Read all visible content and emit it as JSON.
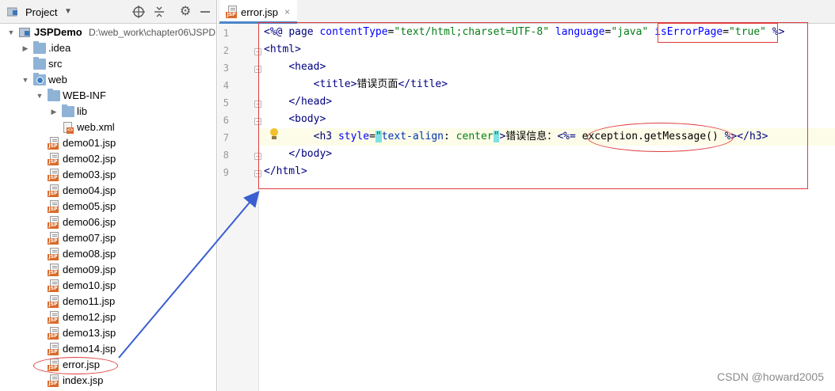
{
  "project_panel": {
    "title": "Project",
    "tree": [
      {
        "id": "jspdemo",
        "label": "JSPDemo",
        "path": "D:\\web_work\\chapter06\\JSPD",
        "depth": 0,
        "expanded": true,
        "icon": "module-icon",
        "bold": true
      },
      {
        "id": "idea",
        "label": ".idea",
        "depth": 1,
        "expanded": false,
        "icon": "folder-icon"
      },
      {
        "id": "src",
        "label": "src",
        "depth": 1,
        "icon": "folder-icon"
      },
      {
        "id": "web",
        "label": "web",
        "depth": 1,
        "expanded": true,
        "icon": "web-folder-icon"
      },
      {
        "id": "web-inf",
        "label": "WEB-INF",
        "depth": 2,
        "expanded": true,
        "icon": "folder-icon"
      },
      {
        "id": "lib",
        "label": "lib",
        "depth": 3,
        "expanded": false,
        "icon": "folder-icon"
      },
      {
        "id": "web-xml",
        "label": "web.xml",
        "depth": 3,
        "icon": "xml-file-icon"
      },
      {
        "id": "demo01",
        "label": "demo01.jsp",
        "depth": 2,
        "icon": "jsp-file-icon"
      },
      {
        "id": "demo02",
        "label": "demo02.jsp",
        "depth": 2,
        "icon": "jsp-file-icon"
      },
      {
        "id": "demo03",
        "label": "demo03.jsp",
        "depth": 2,
        "icon": "jsp-file-icon"
      },
      {
        "id": "demo04",
        "label": "demo04.jsp",
        "depth": 2,
        "icon": "jsp-file-icon"
      },
      {
        "id": "demo05",
        "label": "demo05.jsp",
        "depth": 2,
        "icon": "jsp-file-icon"
      },
      {
        "id": "demo06",
        "label": "demo06.jsp",
        "depth": 2,
        "icon": "jsp-file-icon"
      },
      {
        "id": "demo07",
        "label": "demo07.jsp",
        "depth": 2,
        "icon": "jsp-file-icon"
      },
      {
        "id": "demo08",
        "label": "demo08.jsp",
        "depth": 2,
        "icon": "jsp-file-icon"
      },
      {
        "id": "demo09",
        "label": "demo09.jsp",
        "depth": 2,
        "icon": "jsp-file-icon"
      },
      {
        "id": "demo10",
        "label": "demo10.jsp",
        "depth": 2,
        "icon": "jsp-file-icon"
      },
      {
        "id": "demo11",
        "label": "demo11.jsp",
        "depth": 2,
        "icon": "jsp-file-icon"
      },
      {
        "id": "demo12",
        "label": "demo12.jsp",
        "depth": 2,
        "icon": "jsp-file-icon"
      },
      {
        "id": "demo13",
        "label": "demo13.jsp",
        "depth": 2,
        "icon": "jsp-file-icon"
      },
      {
        "id": "demo14",
        "label": "demo14.jsp",
        "depth": 2,
        "icon": "jsp-file-icon"
      },
      {
        "id": "error",
        "label": "error.jsp",
        "depth": 2,
        "icon": "jsp-file-icon"
      },
      {
        "id": "index",
        "label": "index.jsp",
        "depth": 2,
        "icon": "jsp-file-icon"
      }
    ]
  },
  "editor": {
    "tab": {
      "label": "error.jsp",
      "close": "×"
    },
    "line_numbers": [
      "1",
      "2",
      "3",
      "4",
      "5",
      "6",
      "7",
      "8",
      "9"
    ],
    "lines": [
      {
        "segments": [
          {
            "t": "<%@ ",
            "c": "tk-jsp"
          },
          {
            "t": "page ",
            "c": "tk-tag"
          },
          {
            "t": "contentType",
            "c": "tk-attr"
          },
          {
            "t": "=",
            "c": "tk-plain"
          },
          {
            "t": "\"text/html;charset=UTF-8\"",
            "c": "tk-str"
          },
          {
            "t": " ",
            "c": "tk-plain"
          },
          {
            "t": "language",
            "c": "tk-attr"
          },
          {
            "t": "=",
            "c": "tk-plain"
          },
          {
            "t": "\"java\"",
            "c": "tk-str"
          },
          {
            "t": " ",
            "c": "tk-plain"
          },
          {
            "t": "isErrorPage",
            "c": "tk-attr"
          },
          {
            "t": "=",
            "c": "tk-plain"
          },
          {
            "t": "\"true\"",
            "c": "tk-str"
          },
          {
            "t": " %>",
            "c": "tk-jsp"
          }
        ]
      },
      {
        "segments": [
          {
            "t": "<html>",
            "c": "tk-tag"
          }
        ]
      },
      {
        "segments": [
          {
            "t": "    ",
            "c": "tk-plain"
          },
          {
            "t": "<head>",
            "c": "tk-tag"
          }
        ]
      },
      {
        "segments": [
          {
            "t": "        ",
            "c": "tk-plain"
          },
          {
            "t": "<title>",
            "c": "tk-tag"
          },
          {
            "t": "错误页面",
            "c": "tk-plain cjk"
          },
          {
            "t": "</title>",
            "c": "tk-tag"
          }
        ]
      },
      {
        "segments": [
          {
            "t": "    ",
            "c": "tk-plain"
          },
          {
            "t": "</head>",
            "c": "tk-tag"
          }
        ]
      },
      {
        "segments": [
          {
            "t": "    ",
            "c": "tk-plain"
          },
          {
            "t": "<body>",
            "c": "tk-tag"
          }
        ]
      },
      {
        "segments": [
          {
            "t": "        ",
            "c": "tk-plain"
          },
          {
            "t": "<h3 ",
            "c": "tk-tag"
          },
          {
            "t": "style",
            "c": "tk-attr"
          },
          {
            "t": "=",
            "c": "tk-plain"
          },
          {
            "t": "\"",
            "c": "tk-str tk-quote-hl"
          },
          {
            "t": "text-align",
            "c": "tk-css"
          },
          {
            "t": ": ",
            "c": "tk-plain"
          },
          {
            "t": "center",
            "c": "tk-str"
          },
          {
            "t": "\"",
            "c": "tk-str tk-quote-hl"
          },
          {
            "t": ">",
            "c": "tk-tag"
          },
          {
            "t": "错误信息：",
            "c": "tk-plain cjk"
          },
          {
            "t": "<%=",
            "c": "tk-jsp"
          },
          {
            "t": " exception.getMessage() ",
            "c": "tk-plain"
          },
          {
            "t": "%>",
            "c": "tk-jsp"
          },
          {
            "t": "</h3>",
            "c": "tk-tag"
          }
        ]
      },
      {
        "segments": [
          {
            "t": "    ",
            "c": "tk-plain"
          },
          {
            "t": "</body>",
            "c": "tk-tag"
          }
        ]
      },
      {
        "segments": [
          {
            "t": "</html>",
            "c": "tk-tag"
          }
        ]
      }
    ]
  },
  "watermark": "CSDN @howard2005",
  "colors": {
    "annotation": "#e03c3c",
    "arrow": "#3a5fd0",
    "accent": "#4a86c8"
  }
}
